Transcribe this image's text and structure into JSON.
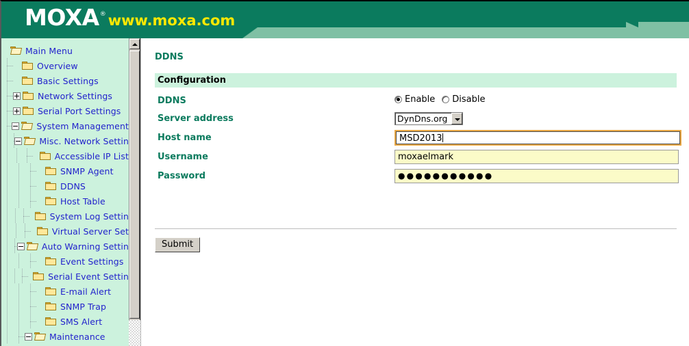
{
  "banner": {
    "logo_text": "MOXA",
    "registered_mark": "®",
    "url": "www.moxa.com"
  },
  "sidebar": {
    "items": [
      {
        "label": "Main Menu",
        "depth": 0,
        "toggle": "none",
        "folder": "open"
      },
      {
        "label": "Overview",
        "depth": 1,
        "toggle": "none",
        "folder": "closed"
      },
      {
        "label": "Basic Settings",
        "depth": 1,
        "toggle": "none",
        "folder": "closed"
      },
      {
        "label": "Network Settings",
        "depth": 1,
        "toggle": "plus",
        "folder": "closed"
      },
      {
        "label": "Serial Port Settings",
        "depth": 1,
        "toggle": "plus",
        "folder": "closed"
      },
      {
        "label": "System Management",
        "depth": 1,
        "toggle": "minus",
        "folder": "open"
      },
      {
        "label": "Misc. Network Settin",
        "depth": 2,
        "toggle": "minus",
        "folder": "open"
      },
      {
        "label": "Accessible IP List",
        "depth": 3,
        "toggle": "none",
        "folder": "closed"
      },
      {
        "label": "SNMP Agent",
        "depth": 3,
        "toggle": "none",
        "folder": "closed"
      },
      {
        "label": "DDNS",
        "depth": 3,
        "toggle": "none",
        "folder": "closed"
      },
      {
        "label": "Host Table",
        "depth": 3,
        "toggle": "none",
        "folder": "closed"
      },
      {
        "label": "System Log Settin",
        "depth": 3,
        "toggle": "none",
        "folder": "closed"
      },
      {
        "label": "Virtual Server Set",
        "depth": 3,
        "toggle": "none",
        "folder": "closed"
      },
      {
        "label": "Auto Warning Settin",
        "depth": 2,
        "toggle": "minus",
        "folder": "open"
      },
      {
        "label": "Event Settings",
        "depth": 3,
        "toggle": "none",
        "folder": "closed"
      },
      {
        "label": "Serial Event Settin",
        "depth": 3,
        "toggle": "none",
        "folder": "closed"
      },
      {
        "label": "E-mail Alert",
        "depth": 3,
        "toggle": "none",
        "folder": "closed"
      },
      {
        "label": "SNMP Trap",
        "depth": 3,
        "toggle": "none",
        "folder": "closed"
      },
      {
        "label": "SMS Alert",
        "depth": 3,
        "toggle": "none",
        "folder": "closed"
      },
      {
        "label": "Maintenance",
        "depth": 2,
        "toggle": "minus",
        "folder": "open"
      }
    ]
  },
  "main": {
    "page_title": "DDNS",
    "section_title": "Configuration",
    "rows": [
      {
        "label": "DDNS"
      },
      {
        "label": "Server address"
      },
      {
        "label": "Host name"
      },
      {
        "label": "Username"
      },
      {
        "label": "Password"
      }
    ],
    "ddns": {
      "enable_label": "Enable",
      "disable_label": "Disable",
      "selected": "Enable"
    },
    "server_address": {
      "value": "DynDns.org",
      "options": [
        "DynDns.org"
      ]
    },
    "host_name": {
      "value": "MSD2013"
    },
    "username": {
      "value": "moxaelmark"
    },
    "password": {
      "masked": "●●●●●●●●●●●"
    },
    "submit_label": "Submit"
  },
  "colors": {
    "banner_dark_green": "#0b7b5e",
    "banner_light_green": "#7fc0a4",
    "sidebar_bg": "#ccf2dd",
    "label_green": "#0b7b5e",
    "tree_link_blue": "#2222cc",
    "input_yellow": "#fbfbc8",
    "focus_orange": "#eba945",
    "logo_yellow": "#ffe800"
  }
}
